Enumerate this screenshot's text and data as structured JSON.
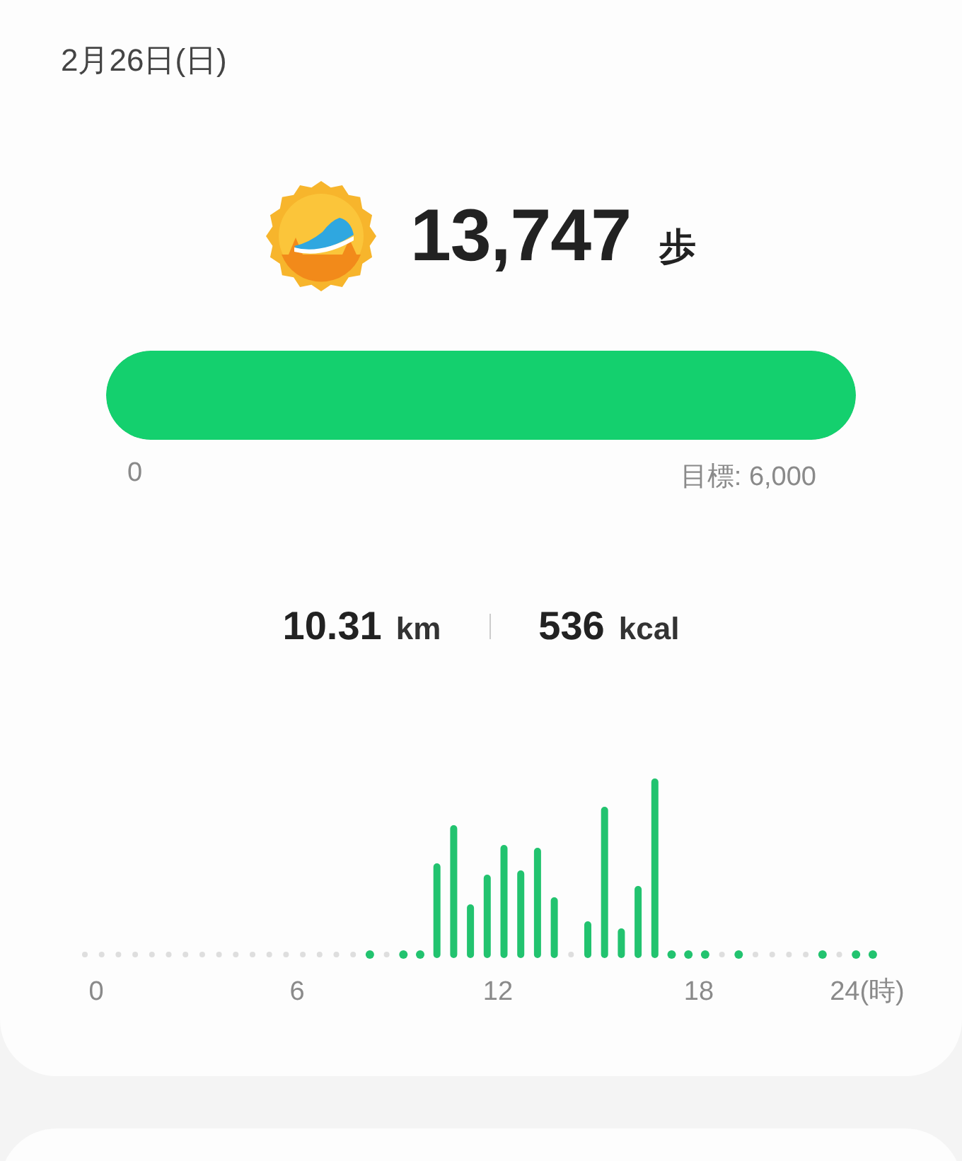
{
  "date": "2月26日(日)",
  "steps": {
    "value": "13,747",
    "unit": "歩"
  },
  "goal_bar": {
    "level": 1,
    "min_label": "0",
    "goal_label": "目標: 6,000"
  },
  "stats": [
    {
      "value": "10.31",
      "unit": "km"
    },
    {
      "value": "536",
      "unit": "kcal"
    }
  ],
  "activity_chart": {
    "axis_labels": [
      "0",
      "6",
      "12",
      "18",
      "24(時)"
    ]
  }
}
